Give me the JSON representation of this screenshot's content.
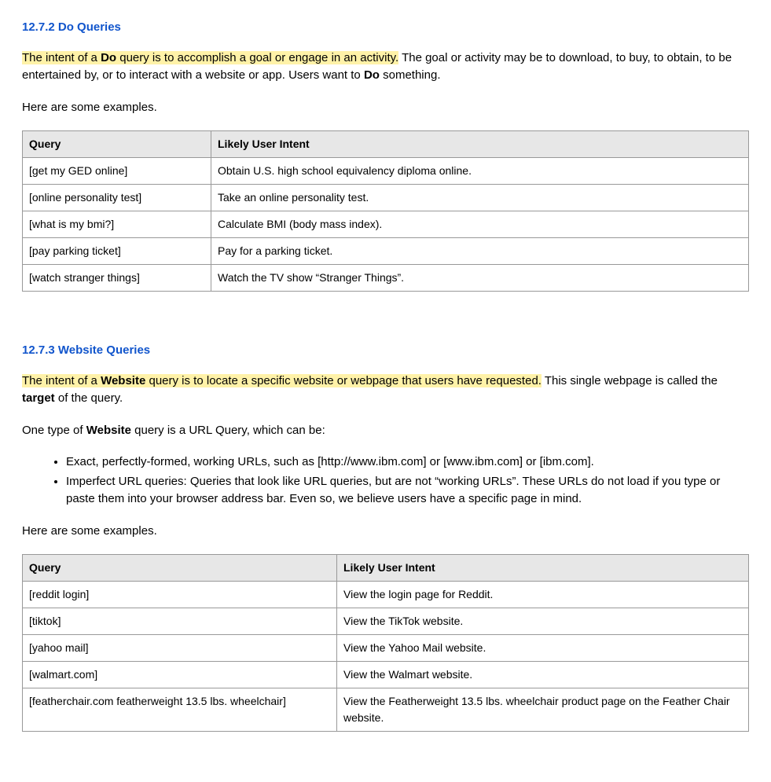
{
  "section1": {
    "heading": "12.7.2 Do Queries",
    "p1_hl_pre": "The intent of a ",
    "p1_hl_b": "Do",
    "p1_hl_post": " query is to accomplish a goal or engage in an activity.",
    "p1_rest_pre": "  The goal or activity may be to download, to buy, to obtain, to be entertained by, or to interact with a website or app.  Users want to ",
    "p1_rest_b": "Do",
    "p1_rest_post": " something.",
    "p2": "Here are some examples.",
    "th1": "Query",
    "th2": "Likely User Intent",
    "rows": [
      {
        "q": "[get my GED online]",
        "i": "Obtain U.S. high school equivalency diploma online."
      },
      {
        "q": "[online personality test]",
        "i": "Take an online personality test."
      },
      {
        "q": "[what is my bmi?]",
        "i": "Calculate BMI (body mass index)."
      },
      {
        "q": "[pay parking ticket]",
        "i": "Pay for a parking ticket."
      },
      {
        "q": "[watch stranger things]",
        "i": "Watch the TV show “Stranger Things”."
      }
    ]
  },
  "section2": {
    "heading": "12.7.3 Website Queries",
    "p1_hl_pre": "The intent of a ",
    "p1_hl_b": "Website",
    "p1_hl_post": " query is to locate a specific website or webpage that users have requested.",
    "p1_rest_pre": "  This single webpage is called the ",
    "p1_rest_b": "target",
    "p1_rest_post": " of the query.",
    "p2_pre": "One type of ",
    "p2_b": "Website",
    "p2_post": " query is a URL Query, which can be:",
    "bullets": [
      "Exact, perfectly-formed, working URLs, such as [http://www.ibm.com] or [www.ibm.com] or [ibm.com].",
      "Imperfect URL queries: Queries that look like URL queries, but are not “working URLs”.  These URLs do not load if you type or paste them into your browser address bar.  Even so, we believe users have a specific page in mind."
    ],
    "p3": "Here are some examples.",
    "th1": "Query",
    "th2": "Likely User Intent",
    "rows": [
      {
        "q": "[reddit login]",
        "i": "View the login page for Reddit."
      },
      {
        "q": "[tiktok]",
        "i": "View the TikTok website."
      },
      {
        "q": "[yahoo mail]",
        "i": "View the Yahoo Mail website."
      },
      {
        "q": "[walmart.com]",
        "i": "View the Walmart website."
      },
      {
        "q": "[featherchair.com featherweight 13.5 lbs. wheelchair]",
        "i": "View the Featherweight 13.5 lbs. wheelchair product page on the Feather Chair website."
      }
    ]
  }
}
